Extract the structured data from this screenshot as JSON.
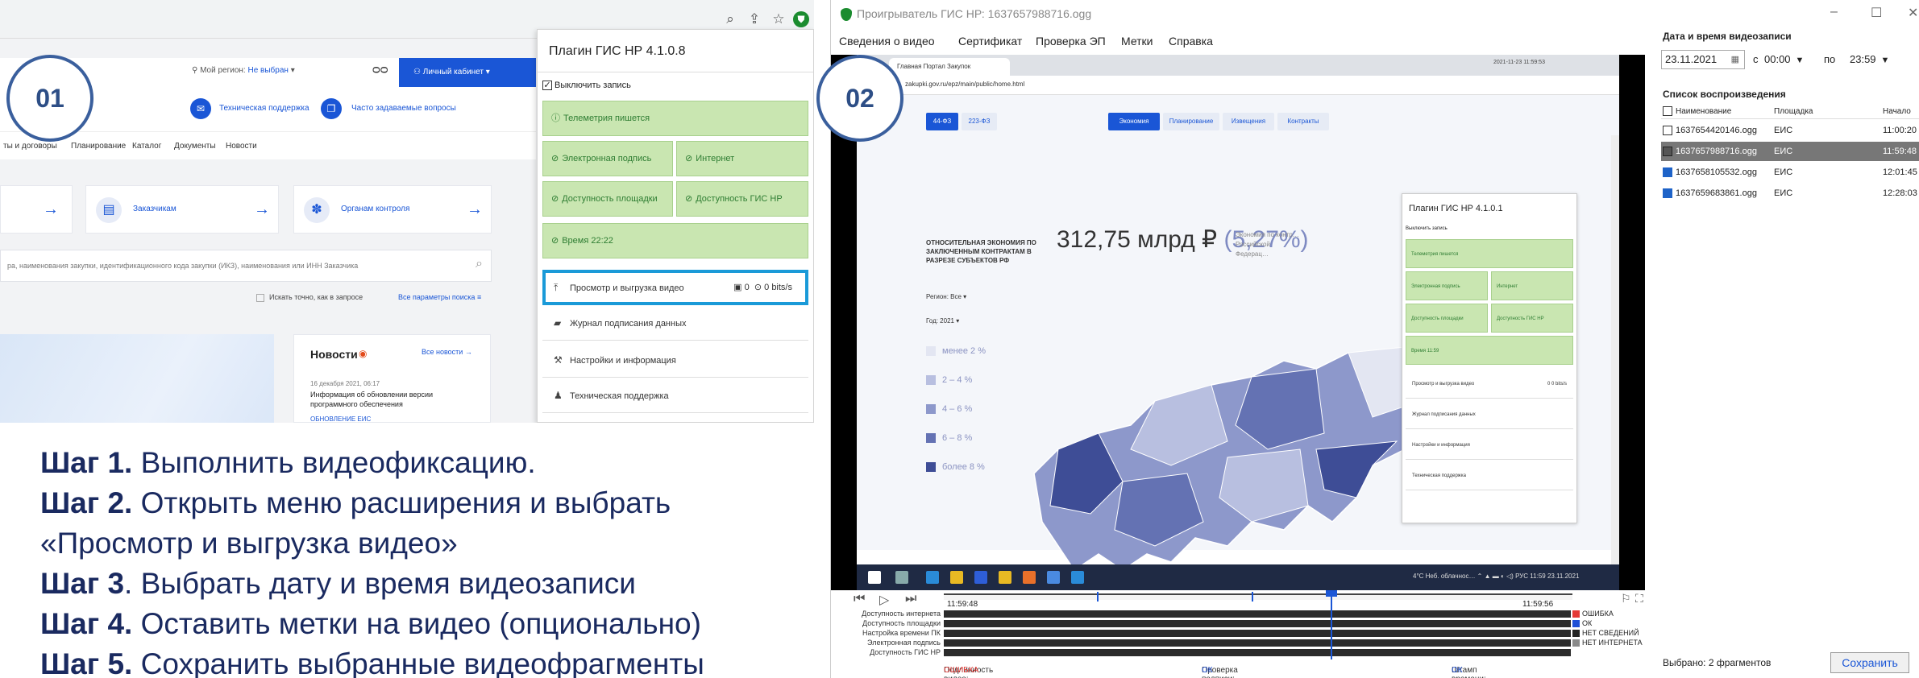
{
  "left": {
    "site": {
      "region_label": "Мой регион:",
      "region_value": "Не выбран",
      "cabinet_button": "Личный кабинет",
      "support_link": "Техническая поддержка",
      "faq_link": "Часто задаваемые вопросы",
      "nav": [
        "ты и договоры",
        "Планирование",
        "Каталог",
        "Документы",
        "Новости"
      ],
      "cards": [
        "Заказчикам",
        "Органам контроля"
      ],
      "search_placeholder": "ра, наименования закупки, идентификационного кода закупки (ИКЗ), наименования или ИНН Заказчика",
      "exact_search": "Искать точно, как в запросе",
      "all_params": "Все параметры поиска",
      "news": {
        "title": "Новости",
        "all_link": "Все новости",
        "date": "16 декабря 2021, 06:17",
        "text": "Информация об обновлении версии программного обеспечения",
        "more": "ОБНОВЛЕНИЕ ЕИС"
      }
    },
    "plugin": {
      "title": "Плагин ГИС НР 4.1.0.8",
      "disable_recording": "Выключить запись",
      "telemetry": "Телеметрия пишется",
      "signature": "Электронная подпись",
      "internet": "Интернет",
      "platform_access": "Доступность площадки",
      "gis_access": "Доступность ГИС НР",
      "time": "Время 22:22",
      "menu": {
        "video": "Просмотр и выгрузка видео",
        "video_count": "0",
        "video_rate": "0 bits/s",
        "journal": "Журнал подписания данных",
        "settings": "Настройки и информация",
        "support": "Техническая поддержка"
      }
    },
    "step_badge": "01"
  },
  "steps": [
    {
      "bold": "Шаг 1.",
      "text": " Выполнить видеофиксацию."
    },
    {
      "bold": "Шаг 2.",
      "text": " Открыть меню расширения и выбрать"
    },
    {
      "bold": "",
      "text": "«Просмотр и выгрузка видео»"
    },
    {
      "bold": "Шаг 3",
      "text": ". Выбрать дату и время видеозаписи"
    },
    {
      "bold": "Шаг 4.",
      "text": " Оставить метки на видео (опционально)"
    },
    {
      "bold": "Шаг 5.",
      "text": " Сохранить выбранные видеофрагменты"
    }
  ],
  "player": {
    "step_badge": "02",
    "title": "Проигрыватель ГИС НР: 1637657988716.ogg",
    "menu": [
      "Сведения о видео",
      "Сертификат",
      "Проверка ЭП",
      "Метки",
      "Справка"
    ],
    "video": {
      "tab": "Главная Портал Закупок",
      "clock": "2021-11-23 11:59:53",
      "url": "zakupki.gov.ru/epz/main/public/home.html",
      "law_tabs": [
        "44-ФЗ",
        "223-ФЗ"
      ],
      "section_tabs": [
        "Экономия",
        "Планирование",
        "Извещения",
        "Контракты"
      ],
      "econ_label": "ОТНОСИТЕЛЬНАЯ ЭКОНОМИЯ ПО ЗАКЛЮЧЕННЫМ КОНТРАКТАМ В РАЗРЕЗЕ СУБЪЕКТОВ РФ",
      "amount": "312,75 млрд ₽",
      "percent": "(5,27%)",
      "econ_note": "Экономия по контр… Российской Федерац…",
      "region": "Регион: Все ▾",
      "year": "Год: 2021 ▾",
      "legend": [
        "менее 2 %",
        "2 – 4 %",
        "4 – 6 %",
        "6 – 8 %",
        "более 8 %"
      ],
      "legend_colors": [
        "#e3e6f2",
        "#b8bfe0",
        "#8d98cb",
        "#6472b3",
        "#3e4d96"
      ],
      "popup_title": "Плагин ГИС НР 4.1.0.1",
      "popup_disable": "Выключить запись",
      "popup_telemetry": "Телеметрия пишется",
      "popup_signature": "Электронная подпись",
      "popup_internet": "Интернет",
      "popup_platform": "Доступность площадки",
      "popup_gis": "Доступность ГИС НР",
      "popup_time": "Время 11:59",
      "popup_video": "Просмотр и выгрузка видео",
      "popup_video_meta": "0   0 bits/s",
      "popup_journal": "Журнал подписания данных",
      "popup_settings": "Настройки и информация",
      "popup_support": "Техническая поддержка",
      "tray": "4°C Неб. облачнос…  ⌃ ▲ ▬ ◐ ◁)  РУС  11:59  23.11.2021"
    },
    "timeline": {
      "time_start": "11:59:48",
      "time_end": "11:59:56",
      "rows": [
        "Доступность интернета",
        "Доступность площадки",
        "Настройка времени ПК",
        "Электронная подпись",
        "Доступность ГИС НР"
      ],
      "legend": [
        {
          "label": "ОШИБКА",
          "color": "#e53935"
        },
        {
          "label": "ОК",
          "color": "#1e4fd6"
        },
        {
          "label": "НЕТ СВЕДЕНИЙ",
          "color": "#222222"
        },
        {
          "label": "НЕТ ИНТЕРНЕТА",
          "color": "#8a8a8a"
        }
      ],
      "authenticity_label": "Подлинность видео:",
      "authenticity_value": "ОШИБКА",
      "signature_label": "Проверка подписи:",
      "signature_value": "ОК",
      "timestamp_label": "Штамп времени:",
      "timestamp_value": "ОК"
    },
    "side": {
      "datetime_title": "Дата и время видеозаписи",
      "date": "23.11.2021",
      "from_label": "с",
      "from_time": "00:00",
      "to_label": "по",
      "to_time": "23:59",
      "playlist_title": "Список воспроизведения",
      "columns": [
        "Наименование",
        "Площадка",
        "Начало"
      ],
      "rows": [
        {
          "name": "1637654420146.ogg",
          "site": "ЕИС",
          "start": "11:00:20",
          "state": "unchecked"
        },
        {
          "name": "1637657988716.ogg",
          "site": "ЕИС",
          "start": "11:59:48",
          "state": "current"
        },
        {
          "name": "1637658105532.ogg",
          "site": "ЕИС",
          "start": "12:01:45",
          "state": "checked"
        },
        {
          "name": "1637659683861.ogg",
          "site": "ЕИС",
          "start": "12:28:03",
          "state": "checked"
        }
      ],
      "selected_count": "Выбрано: 2 фрагментов",
      "save_button": "Сохранить"
    }
  }
}
